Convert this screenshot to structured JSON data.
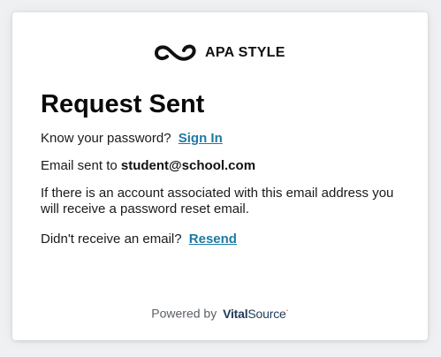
{
  "logo": {
    "text": "APA STYLE",
    "icon": "apa-wave-icon"
  },
  "heading": "Request Sent",
  "know_password": {
    "prompt": "Know your password?",
    "link": "Sign In"
  },
  "email_sent": {
    "prefix": "Email sent to",
    "address": "student@school.com"
  },
  "info": "If there is an account associated with this email address you will receive a password reset email.",
  "resend": {
    "prompt": "Didn't receive an email?",
    "link": "Resend"
  },
  "footer": {
    "prefix": "Powered by",
    "brand_vital": "Vital",
    "brand_source": "Source"
  },
  "colors": {
    "link": "#1d7aa3",
    "background": "#eef0f2",
    "card": "#ffffff",
    "brand": "#1f3a5a",
    "brand_accent": "#e58c2b"
  }
}
